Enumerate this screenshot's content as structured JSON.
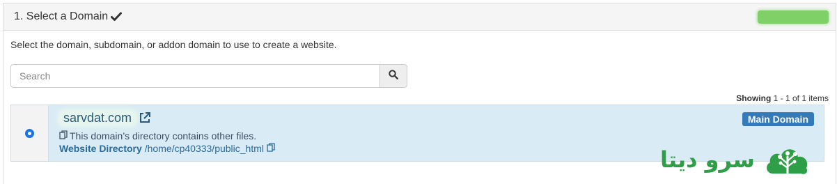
{
  "panel": {
    "title": "1. Select a Domain",
    "instructions": "Select the domain, subdomain, or addon domain to use to create a website."
  },
  "search": {
    "placeholder": "Search"
  },
  "results": {
    "showing_label": "Showing",
    "showing_range": "1 - 1 of 1 items"
  },
  "domain_row": {
    "selected": true,
    "domain": "sarvdat.com",
    "note": "This domain’s directory contains other files.",
    "directory_label": "Website Directory",
    "directory_path": "/home/cp40333/public_html",
    "badge": "Main Domain"
  },
  "branding": {
    "text": "سرو دیتا"
  },
  "colors": {
    "header_bg": "#f5f5f5",
    "row_bg": "#d9ebf5",
    "badge_bg": "#337ab7",
    "brand_green": "#2e9e47",
    "status_green": "#7ed067"
  },
  "icons": {
    "title": "checkmark-icon",
    "search": "magnifier-icon",
    "domain_link": "external-link-icon",
    "copy": "copy-icon",
    "brand": "tree-cloud-logo"
  }
}
